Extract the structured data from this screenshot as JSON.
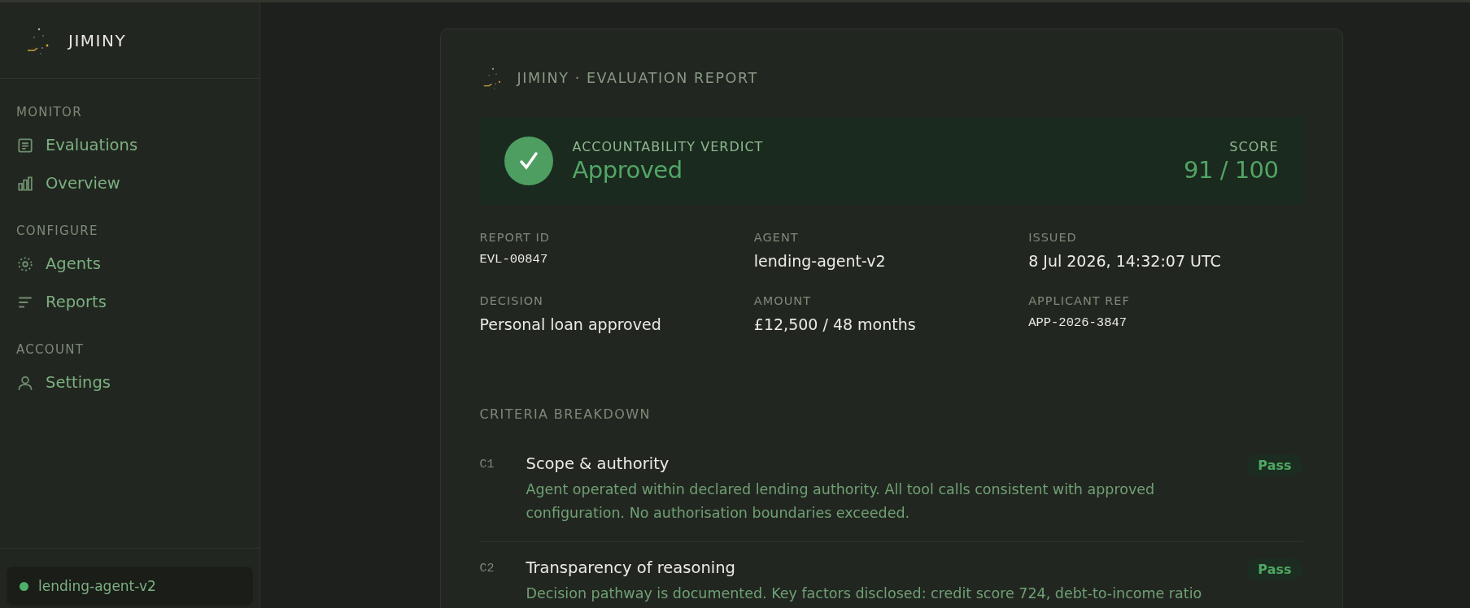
{
  "sidebar": {
    "brand": "JIMINY",
    "sections": [
      {
        "heading": "MONITOR",
        "items": [
          {
            "label": "Evaluations"
          },
          {
            "label": "Overview"
          }
        ]
      },
      {
        "heading": "CONFIGURE",
        "items": [
          {
            "label": "Agents"
          },
          {
            "label": "Reports"
          }
        ]
      },
      {
        "heading": "ACCOUNT",
        "items": [
          {
            "label": "Settings"
          }
        ]
      }
    ],
    "agent_status": {
      "label": "lending-agent-v2"
    }
  },
  "report": {
    "header": "JIMINY · EVALUATION REPORT",
    "verdict": {
      "label": "ACCOUNTABILITY VERDICT",
      "value": "Approved",
      "score_label": "SCORE",
      "score": "91 / 100"
    },
    "fields": [
      {
        "label": "REPORT ID",
        "value": "EVL-00847",
        "kind": "mono"
      },
      {
        "label": "AGENT",
        "value": "lending-agent-v2",
        "kind": "text"
      },
      {
        "label": "ISSUED",
        "value": "8 Jul 2026, 14:32:07 UTC",
        "kind": "text"
      },
      {
        "label": "DECISION",
        "value": "Personal loan approved",
        "kind": "text"
      },
      {
        "label": "AMOUNT",
        "value": "£12,500 / 48 months",
        "kind": "text"
      },
      {
        "label": "APPLICANT REF",
        "value": "APP-2026-3847",
        "kind": "mono"
      }
    ],
    "criteria_heading": "CRITERIA BREAKDOWN",
    "criteria": [
      {
        "code": "C1",
        "title": "Scope & authority",
        "description": "Agent operated within declared lending authority. All tool calls consistent with approved configuration. No authorisation boundaries exceeded.",
        "result": "Pass"
      },
      {
        "code": "C2",
        "title": "Transparency of reasoning",
        "description": "Decision pathway is documented. Key factors disclosed: credit score 724, debt-to-income ratio",
        "result": "Pass"
      }
    ]
  }
}
